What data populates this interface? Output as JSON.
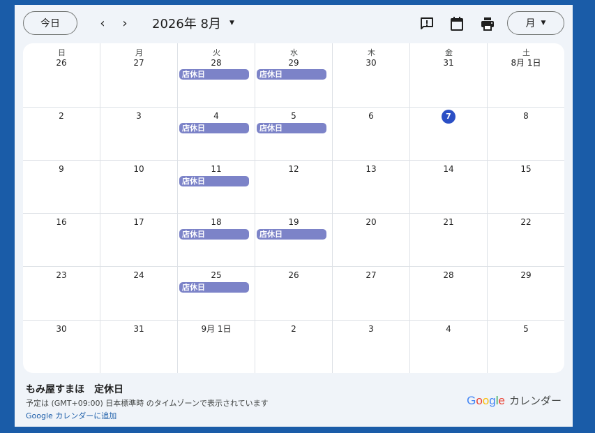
{
  "toolbar": {
    "today_label": "今日",
    "prev_icon": "chevron-left-icon",
    "next_icon": "chevron-right-icon",
    "month_title": "2026年 8月",
    "view_label": "月",
    "icons": [
      "feedback-icon",
      "calendar-icon",
      "print-icon"
    ]
  },
  "weekdays": [
    "日",
    "月",
    "火",
    "水",
    "木",
    "金",
    "土"
  ],
  "weeks": [
    [
      {
        "label": "26"
      },
      {
        "label": "27"
      },
      {
        "label": "28",
        "event": "店休日"
      },
      {
        "label": "29",
        "event": "店休日"
      },
      {
        "label": "30"
      },
      {
        "label": "31"
      },
      {
        "label": "8月 1日"
      }
    ],
    [
      {
        "label": "2"
      },
      {
        "label": "3"
      },
      {
        "label": "4",
        "event": "店休日"
      },
      {
        "label": "5",
        "event": "店休日"
      },
      {
        "label": "6"
      },
      {
        "label": "7",
        "today": true
      },
      {
        "label": "8"
      }
    ],
    [
      {
        "label": "9"
      },
      {
        "label": "10"
      },
      {
        "label": "11",
        "event": "店休日"
      },
      {
        "label": "12"
      },
      {
        "label": "13"
      },
      {
        "label": "14"
      },
      {
        "label": "15"
      }
    ],
    [
      {
        "label": "16"
      },
      {
        "label": "17"
      },
      {
        "label": "18",
        "event": "店休日"
      },
      {
        "label": "19",
        "event": "店休日"
      },
      {
        "label": "20"
      },
      {
        "label": "21"
      },
      {
        "label": "22"
      }
    ],
    [
      {
        "label": "23"
      },
      {
        "label": "24"
      },
      {
        "label": "25",
        "event": "店休日"
      },
      {
        "label": "26"
      },
      {
        "label": "27"
      },
      {
        "label": "28"
      },
      {
        "label": "29"
      }
    ],
    [
      {
        "label": "30"
      },
      {
        "label": "31"
      },
      {
        "label": "9月 1日"
      },
      {
        "label": "2"
      },
      {
        "label": "3"
      },
      {
        "label": "4"
      },
      {
        "label": "5"
      }
    ]
  ],
  "footer": {
    "calendar_name": "もみ屋すまほ　定休日",
    "timezone_note": "予定は (GMT+09:00) 日本標準時 のタイムゾーンで表示されています",
    "add_link": "Google カレンダーに追加",
    "brand_logo": [
      "G",
      "o",
      "o",
      "g",
      "l",
      "e"
    ],
    "brand_text": "カレンダー"
  },
  "colors": {
    "background": "#1a5ca8",
    "event": "#7c83c8",
    "today": "#2b4fc5",
    "logo": [
      "#4285f4",
      "#ea4335",
      "#fbbc05",
      "#4285f4",
      "#34a853",
      "#ea4335"
    ]
  }
}
